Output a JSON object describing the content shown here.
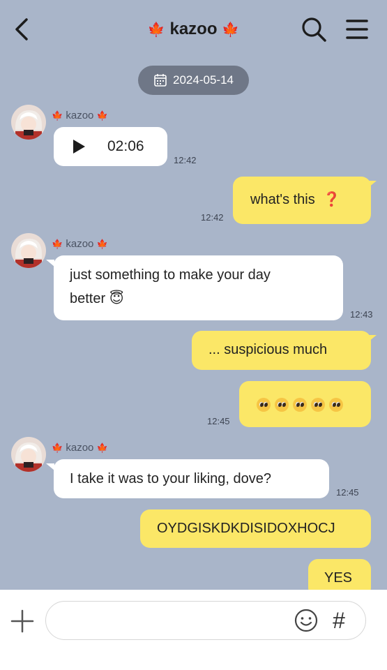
{
  "header": {
    "title": "kazoo",
    "leaf": "🍁"
  },
  "date": "2024-05-14",
  "messages": [
    {
      "sender": "kazoo",
      "voice_duration": "02:06",
      "time": "12:42"
    },
    {
      "text": "what's this",
      "emoji": "❓",
      "time": "12:42"
    },
    {
      "sender": "kazoo",
      "line1": "just something to make your day",
      "line2": "better",
      "emoji": "😇",
      "time": "12:43"
    },
    {
      "text": "... suspicious much"
    },
    {
      "emoji_count": 5,
      "time": "12:45"
    },
    {
      "sender": "kazoo",
      "text": "I take it was to your liking, dove?",
      "time": "12:45"
    },
    {
      "text": "OYDGISKDKDISIDOXHOCJ"
    },
    {
      "text": "YES"
    }
  ],
  "input": {
    "placeholder": "",
    "value": ""
  },
  "colors": {
    "chat_bg": "#a9b5c9",
    "outgoing": "#fbe767",
    "incoming": "#ffffff",
    "date_pill": "#6f7787"
  },
  "icons": [
    "back-icon",
    "search-icon",
    "menu-icon",
    "calendar-icon",
    "play-icon",
    "plus-icon",
    "emoji-icon",
    "hash-icon"
  ]
}
